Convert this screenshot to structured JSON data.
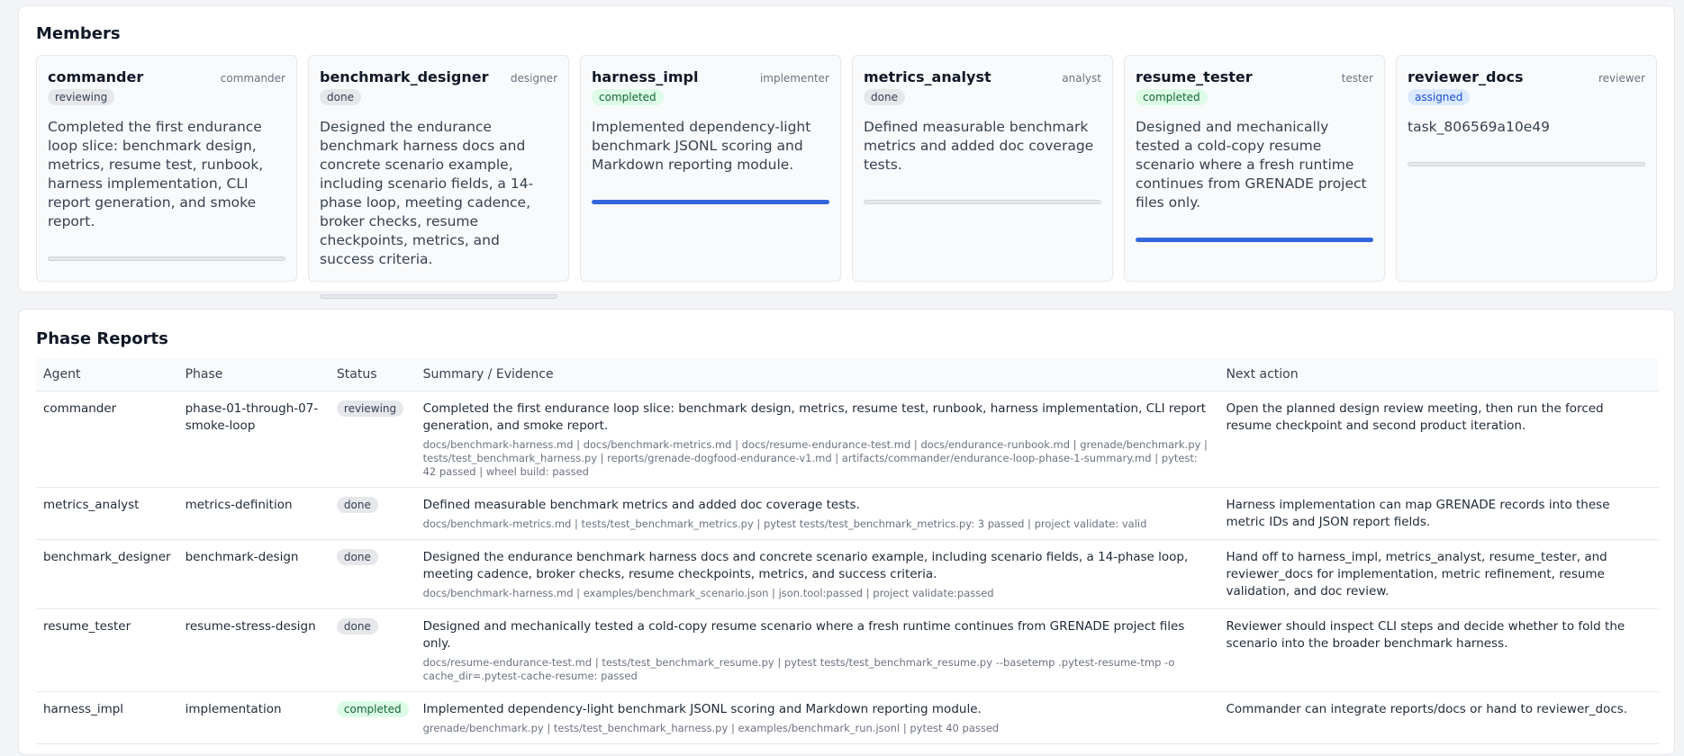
{
  "members": {
    "title": "Members",
    "cards": [
      {
        "name": "commander",
        "role": "commander",
        "status": "reviewing",
        "status_tone": "gray",
        "text": "Completed the first endurance loop slice: benchmark design, metrics, resume test, runbook, harness implementation, CLI report generation, and smoke report.",
        "progress": 0
      },
      {
        "name": "benchmark_designer",
        "role": "designer",
        "status": "done",
        "status_tone": "gray",
        "text": "Designed the endurance benchmark harness docs and concrete scenario example, including scenario fields, a 14-phase loop, meeting cadence, broker checks, resume checkpoints, metrics, and success criteria.",
        "progress": 0
      },
      {
        "name": "harness_impl",
        "role": "implementer",
        "status": "completed",
        "status_tone": "green",
        "text": "Implemented dependency-light benchmark JSONL scoring and Markdown reporting module.",
        "progress": 1
      },
      {
        "name": "metrics_analyst",
        "role": "analyst",
        "status": "done",
        "status_tone": "gray",
        "text": "Defined measurable benchmark metrics and added doc coverage tests.",
        "progress": 0
      },
      {
        "name": "resume_tester",
        "role": "tester",
        "status": "completed",
        "status_tone": "green",
        "text": "Designed and mechanically tested a cold-copy resume scenario where a fresh runtime continues from GRENADE project files only.",
        "progress": 1
      },
      {
        "name": "reviewer_docs",
        "role": "reviewer",
        "status": "assigned",
        "status_tone": "blue",
        "text": "task_806569a10e49",
        "progress": 0
      }
    ]
  },
  "phase_reports": {
    "title": "Phase Reports",
    "columns": [
      "Agent",
      "Phase",
      "Status",
      "Summary / Evidence",
      "Next action"
    ],
    "rows": [
      {
        "agent": "commander",
        "phase": "phase-01-through-07-smoke-loop",
        "status": "reviewing",
        "status_tone": "gray",
        "summary": "Completed the first endurance loop slice: benchmark design, metrics, resume test, runbook, harness implementation, CLI report generation, and smoke report.",
        "evidence": "docs/benchmark-harness.md | docs/benchmark-metrics.md | docs/resume-endurance-test.md | docs/endurance-runbook.md | grenade/benchmark.py | tests/test_benchmark_harness.py | reports/grenade-dogfood-endurance-v1.md | artifacts/commander/endurance-loop-phase-1-summary.md | pytest: 42 passed | wheel build: passed",
        "next": "Open the planned design review meeting, then run the forced resume checkpoint and second product iteration."
      },
      {
        "agent": "metrics_analyst",
        "phase": "metrics-definition",
        "status": "done",
        "status_tone": "gray",
        "summary": "Defined measurable benchmark metrics and added doc coverage tests.",
        "evidence": "docs/benchmark-metrics.md | tests/test_benchmark_metrics.py | pytest tests/test_benchmark_metrics.py: 3 passed | project validate: valid",
        "next": "Harness implementation can map GRENADE records into these metric IDs and JSON report fields."
      },
      {
        "agent": "benchmark_designer",
        "phase": "benchmark-design",
        "status": "done",
        "status_tone": "gray",
        "summary": "Designed the endurance benchmark harness docs and concrete scenario example, including scenario fields, a 14-phase loop, meeting cadence, broker checks, resume checkpoints, metrics, and success criteria.",
        "evidence": "docs/benchmark-harness.md | examples/benchmark_scenario.json | json.tool:passed | project validate:passed",
        "next": "Hand off to harness_impl, metrics_analyst, resume_tester, and reviewer_docs for implementation, metric refinement, resume validation, and doc review."
      },
      {
        "agent": "resume_tester",
        "phase": "resume-stress-design",
        "status": "done",
        "status_tone": "gray",
        "summary": "Designed and mechanically tested a cold-copy resume scenario where a fresh runtime continues from GRENADE project files only.",
        "evidence": "docs/resume-endurance-test.md | tests/test_benchmark_resume.py | pytest tests/test_benchmark_resume.py --basetemp .pytest-resume-tmp -o cache_dir=.pytest-cache-resume: passed",
        "next": "Reviewer should inspect CLI steps and decide whether to fold the scenario into the broader benchmark harness."
      },
      {
        "agent": "harness_impl",
        "phase": "implementation",
        "status": "completed",
        "status_tone": "green",
        "summary": "Implemented dependency-light benchmark JSONL scoring and Markdown reporting module.",
        "evidence": "grenade/benchmark.py | tests/test_benchmark_harness.py | examples/benchmark_run.jsonl | pytest 40 passed",
        "next": "Commander can integrate reports/docs or hand to reviewer_docs."
      }
    ]
  }
}
